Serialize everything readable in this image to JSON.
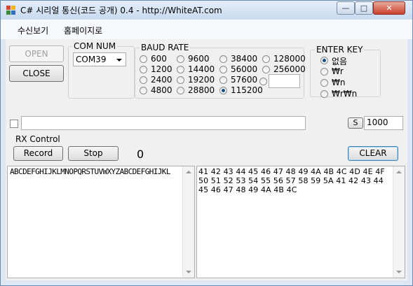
{
  "window": {
    "title": "C# 시리얼 통신(코드 공개) 0.4 - http://WhiteAT.com"
  },
  "menu": {
    "items": [
      "수신보기",
      "홈페이지로"
    ]
  },
  "connection": {
    "open_label": "OPEN",
    "close_label": "CLOSE"
  },
  "com": {
    "label": "COM NUM",
    "selected": "COM39"
  },
  "baud": {
    "label": "BAUD RATE",
    "options": [
      "600",
      "1200",
      "2400",
      "4800",
      "9600",
      "14400",
      "19200",
      "28800",
      "38400",
      "56000",
      "57600",
      "115200",
      "128000",
      "256000"
    ],
    "selected": "115200",
    "custom_value": ""
  },
  "enter_key": {
    "label": "ENTER KEY",
    "options": [
      "없음",
      "₩r",
      "₩n",
      "₩r₩n"
    ],
    "selected": "없음"
  },
  "send": {
    "text": "",
    "send_label": "S",
    "interval": "1000",
    "checkbox_checked": false
  },
  "rx": {
    "label": "RX Control",
    "record_label": "Record",
    "stop_label": "Stop",
    "count": "0",
    "clear_label": "CLEAR"
  },
  "output": {
    "ascii": "ABCDEFGHIJKLMNOPQRSTUVWXYZABCDEFGHIJKL",
    "hex_lines": [
      "41 42 43 44 45 46 47 48 49 4A 4B 4C 4D 4E 4F",
      "50 51 52 53 54 55 56 57 58 59 5A 41 42 43 44",
      "45 46 47 48 49 4A 4B 4C"
    ]
  }
}
